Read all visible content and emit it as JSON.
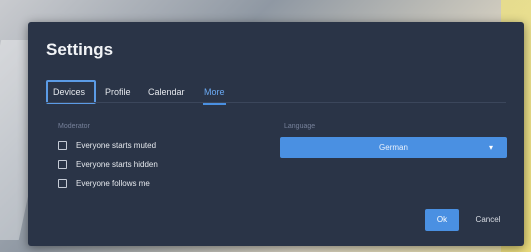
{
  "dialog": {
    "title": "Settings",
    "tabs": [
      {
        "label": "Devices"
      },
      {
        "label": "Profile"
      },
      {
        "label": "Calendar"
      },
      {
        "label": "More"
      }
    ],
    "moderator": {
      "section_label": "Moderator",
      "options": [
        {
          "label": "Everyone starts muted",
          "checked": false
        },
        {
          "label": "Everyone starts hidden",
          "checked": false
        },
        {
          "label": "Everyone follows me",
          "checked": false
        }
      ]
    },
    "language": {
      "section_label": "Language",
      "selected": "German",
      "caret_icon": "chevron-down-icon"
    },
    "buttons": {
      "ok_label": "Ok",
      "cancel_label": "Cancel"
    }
  },
  "colors": {
    "dialog_bg": "#2a3447",
    "accent": "#4a90e2",
    "text": "#e6e9ee",
    "muted_text": "#76819a"
  }
}
